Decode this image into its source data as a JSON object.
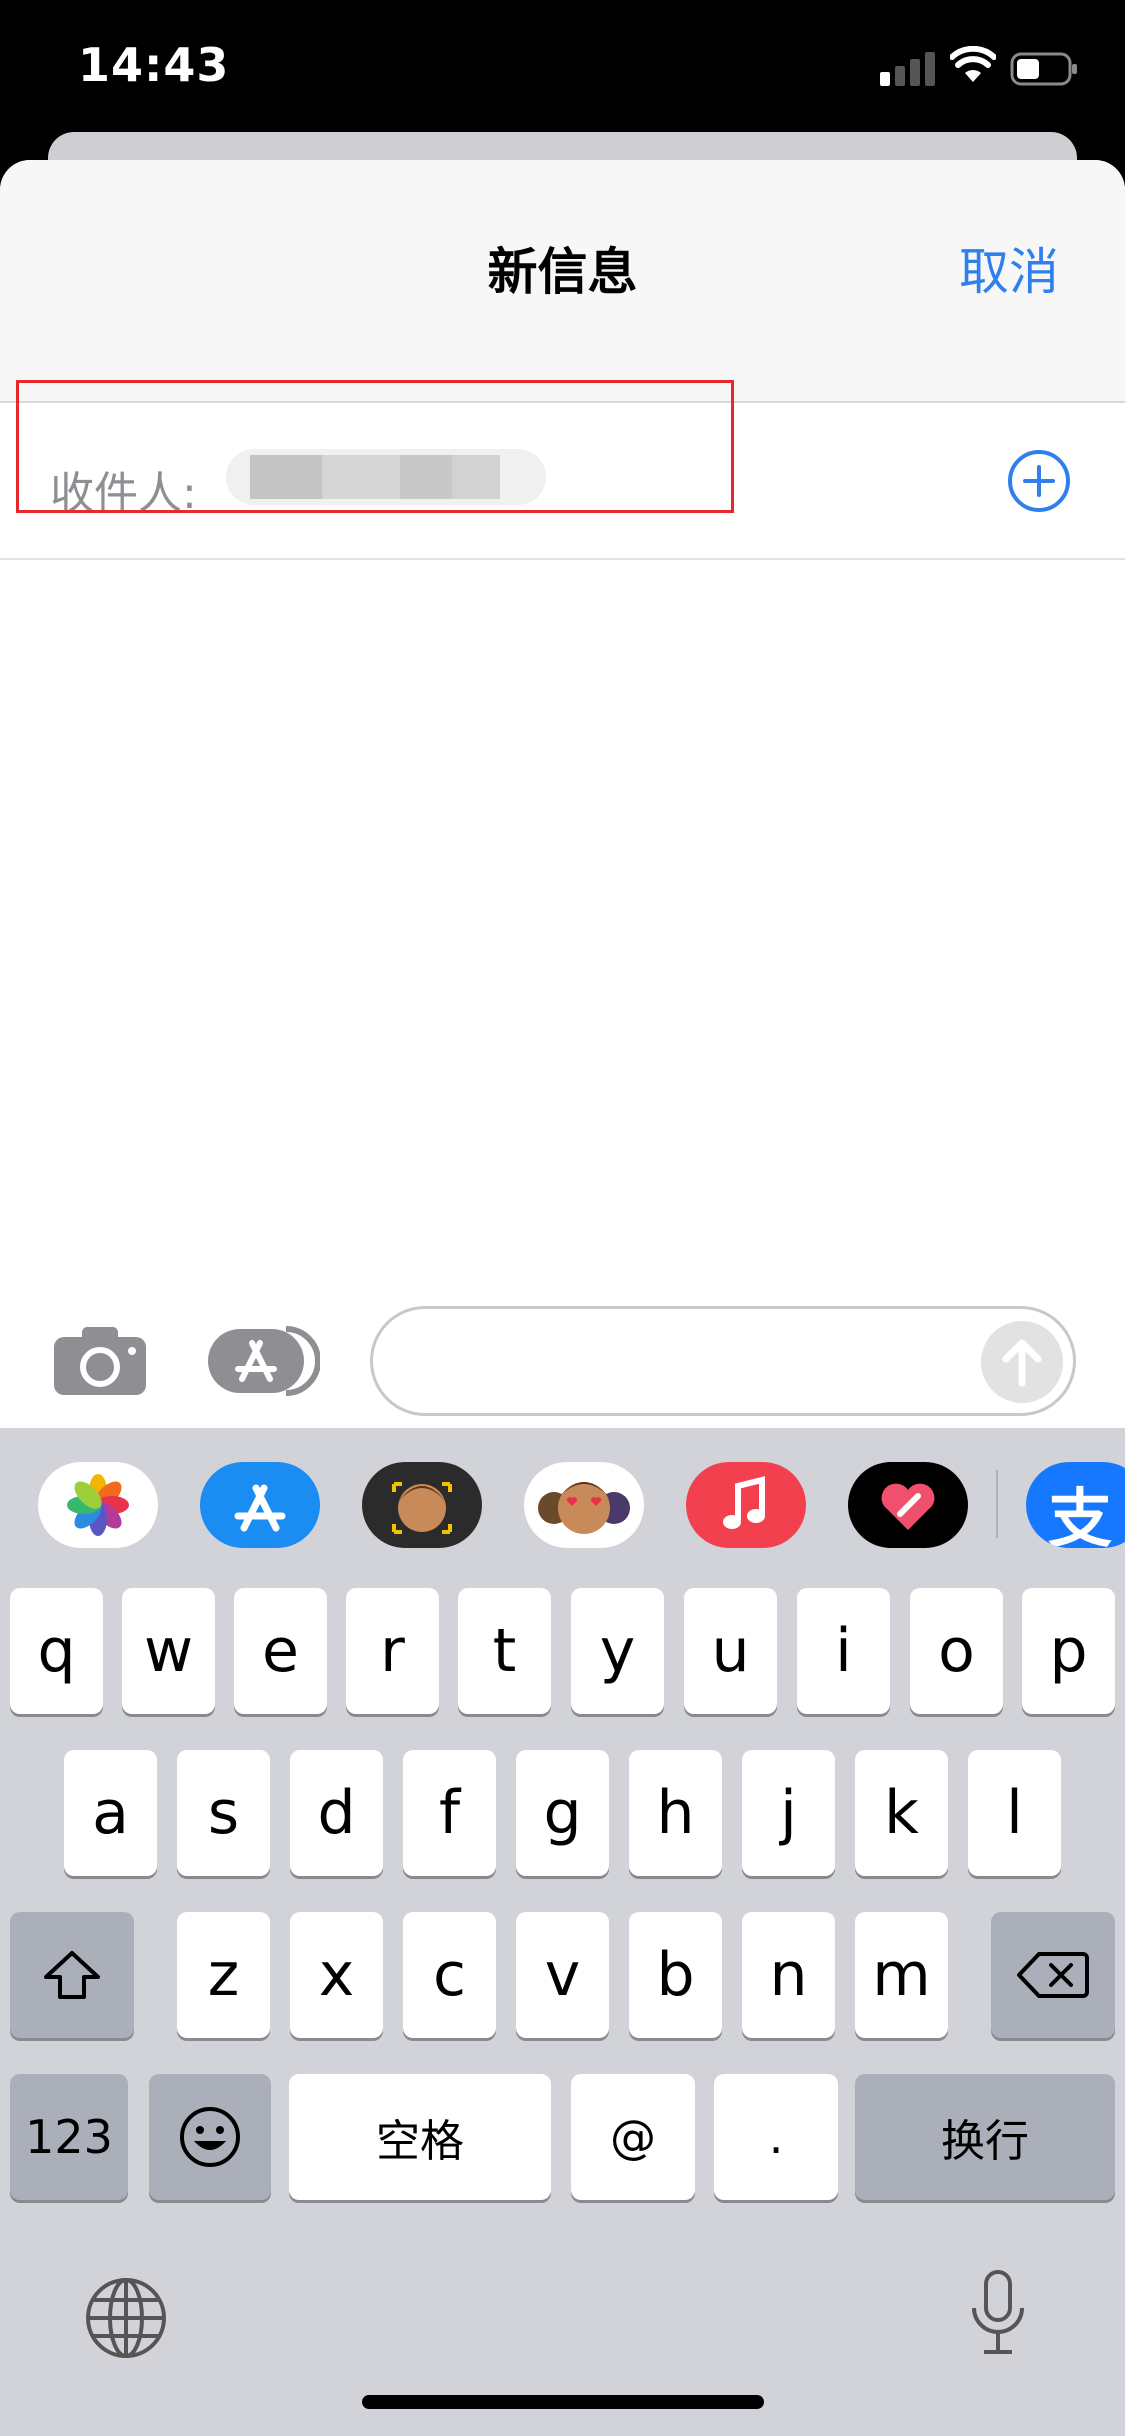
{
  "status_bar": {
    "time": "14:43"
  },
  "header": {
    "title": "新信息",
    "cancel_label": "取消"
  },
  "recipient": {
    "label": "收件人:"
  },
  "compose": {
    "placeholder": ""
  },
  "app_strip": [
    {
      "name": "photos"
    },
    {
      "name": "app-store"
    },
    {
      "name": "memoji-stickers"
    },
    {
      "name": "animoji"
    },
    {
      "name": "music"
    },
    {
      "name": "digital-touch"
    },
    {
      "name": "alipay",
      "glyph": "支"
    }
  ],
  "keyboard": {
    "row1": [
      "q",
      "w",
      "e",
      "r",
      "t",
      "y",
      "u",
      "i",
      "o",
      "p"
    ],
    "row2": [
      "a",
      "s",
      "d",
      "f",
      "g",
      "h",
      "j",
      "k",
      "l"
    ],
    "row3": [
      "z",
      "x",
      "c",
      "v",
      "b",
      "n",
      "m"
    ],
    "numbers_label": "123",
    "space_label": "空格",
    "at_label": "@",
    "dot_label": ".",
    "return_label": "换行"
  },
  "colors": {
    "accent": "#2f80ed",
    "highlight": "#e4282c",
    "keyboard_bg": "#d1d3d9"
  }
}
